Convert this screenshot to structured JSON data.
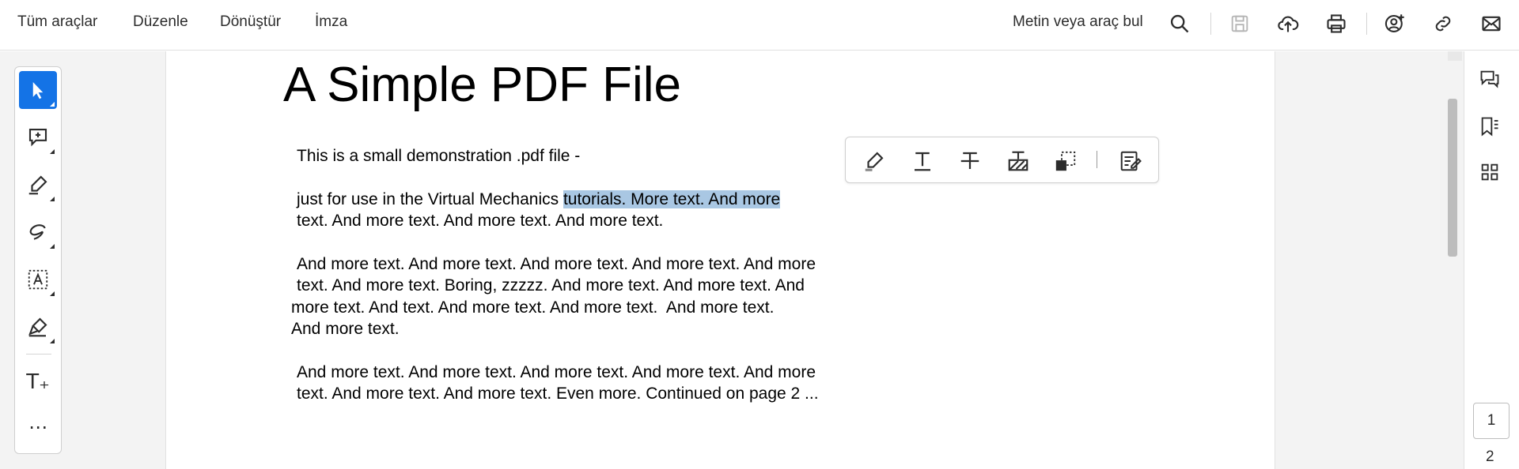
{
  "menu": {
    "all_tools": "Tüm araçlar",
    "edit": "Düzenle",
    "convert": "Dönüştür",
    "sign": "İmza"
  },
  "search": {
    "label": "Metin veya araç bul"
  },
  "toolbar_icons": [
    "search-icon",
    "save-icon",
    "upload-icon",
    "print-icon",
    "share-user-icon",
    "link-icon",
    "mail-icon"
  ],
  "tool_rail": [
    "select-pointer-icon",
    "add-comment-icon",
    "highlight-pen-icon",
    "draw-freehand-icon",
    "text-select-icon",
    "sign-icon",
    "add-text-icon",
    "more-icon"
  ],
  "add_text_glyph": "T₊",
  "more_glyph": "⋯",
  "document": {
    "title": "A Simple PDF File",
    "line1": "This is a small demonstration .pdf file -",
    "line2_pre": "just for use in the Virtual Mechanics ",
    "line2_highlight": "tutorials. More text. And more",
    "line3": "text. And more text. And more text. And more text.",
    "line4": "And more text. And more text. And more text. And more text. And more",
    "line5": "text. And more text. Boring, zzzzz. And more text. And more text. And",
    "line6": "more text. And text. And more text. And more text.  And more text.",
    "line7": "And more text.",
    "line8": "And more text. And more text. And more text. And more text. And more",
    "line9": "text. And more text. And more text. Even more. Continued on page 2 ..."
  },
  "selection_toolbar": [
    "highlight-icon",
    "underline-icon",
    "strikethrough-icon",
    "redact-icon",
    "copy-icon",
    "edit-text-icon"
  ],
  "right_panel": [
    "comments-icon",
    "bookmarks-icon",
    "thumbnails-icon"
  ],
  "page_nav": {
    "current": "1",
    "total": "2"
  },
  "colors": {
    "accent": "#1473e6",
    "highlight": "#a9c7e3"
  }
}
